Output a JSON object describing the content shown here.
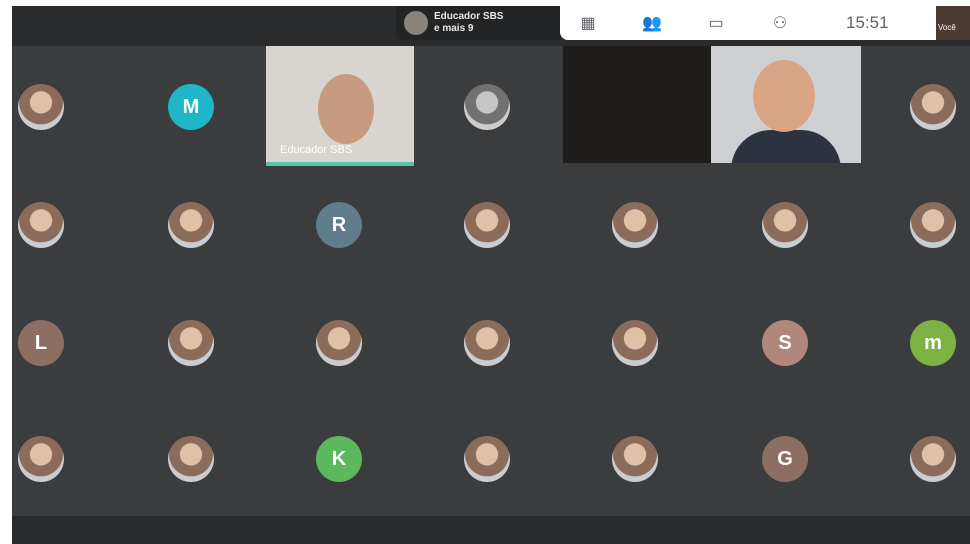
{
  "presenter": {
    "name_line": "Educador SBS",
    "more_line": "e mais 9"
  },
  "toolbar": {
    "time": "15:51",
    "you_label": "Você"
  },
  "videos": {
    "teacher_label": "Educador SBS"
  },
  "tiles": [
    {
      "initial": "",
      "color": "#b85c4a"
    },
    {
      "initial": "M",
      "color": "#1eb6c8"
    },
    {
      "initial": "",
      "color": "#8a8c92"
    },
    {
      "initial": "",
      "color": "#c46b7b"
    },
    {
      "initial": "",
      "color": "#6a6d63"
    },
    {
      "initial": "",
      "color": "#6d4b4b"
    },
    {
      "initial": "R",
      "color": "#607d8b"
    },
    {
      "initial": "",
      "color": "#4b7ea8"
    },
    {
      "initial": "",
      "color": "#3a78c4"
    },
    {
      "initial": "",
      "color": "#9b6b5f"
    },
    {
      "initial": "",
      "color": "#6d6f72"
    },
    {
      "initial": "L",
      "color": "#8d6e63"
    },
    {
      "initial": "",
      "color": "#5b7bb3"
    },
    {
      "initial": "",
      "color": "#2f5f56"
    },
    {
      "initial": "",
      "color": "#6fa7d6"
    },
    {
      "initial": "",
      "color": "#6f7c8e"
    },
    {
      "initial": "S",
      "color": "#b0877a"
    },
    {
      "initial": "m",
      "color": "#7cb342"
    },
    {
      "initial": "",
      "color": "#7b5a4f"
    },
    {
      "initial": "",
      "color": "#a15b22"
    },
    {
      "initial": "K",
      "color": "#5cb85c"
    },
    {
      "initial": "",
      "color": "#6b6262"
    },
    {
      "initial": "",
      "color": "#4a3f3d"
    },
    {
      "initial": "G",
      "color": "#8d6e63"
    },
    {
      "initial": "",
      "color": "#5b6775"
    }
  ]
}
